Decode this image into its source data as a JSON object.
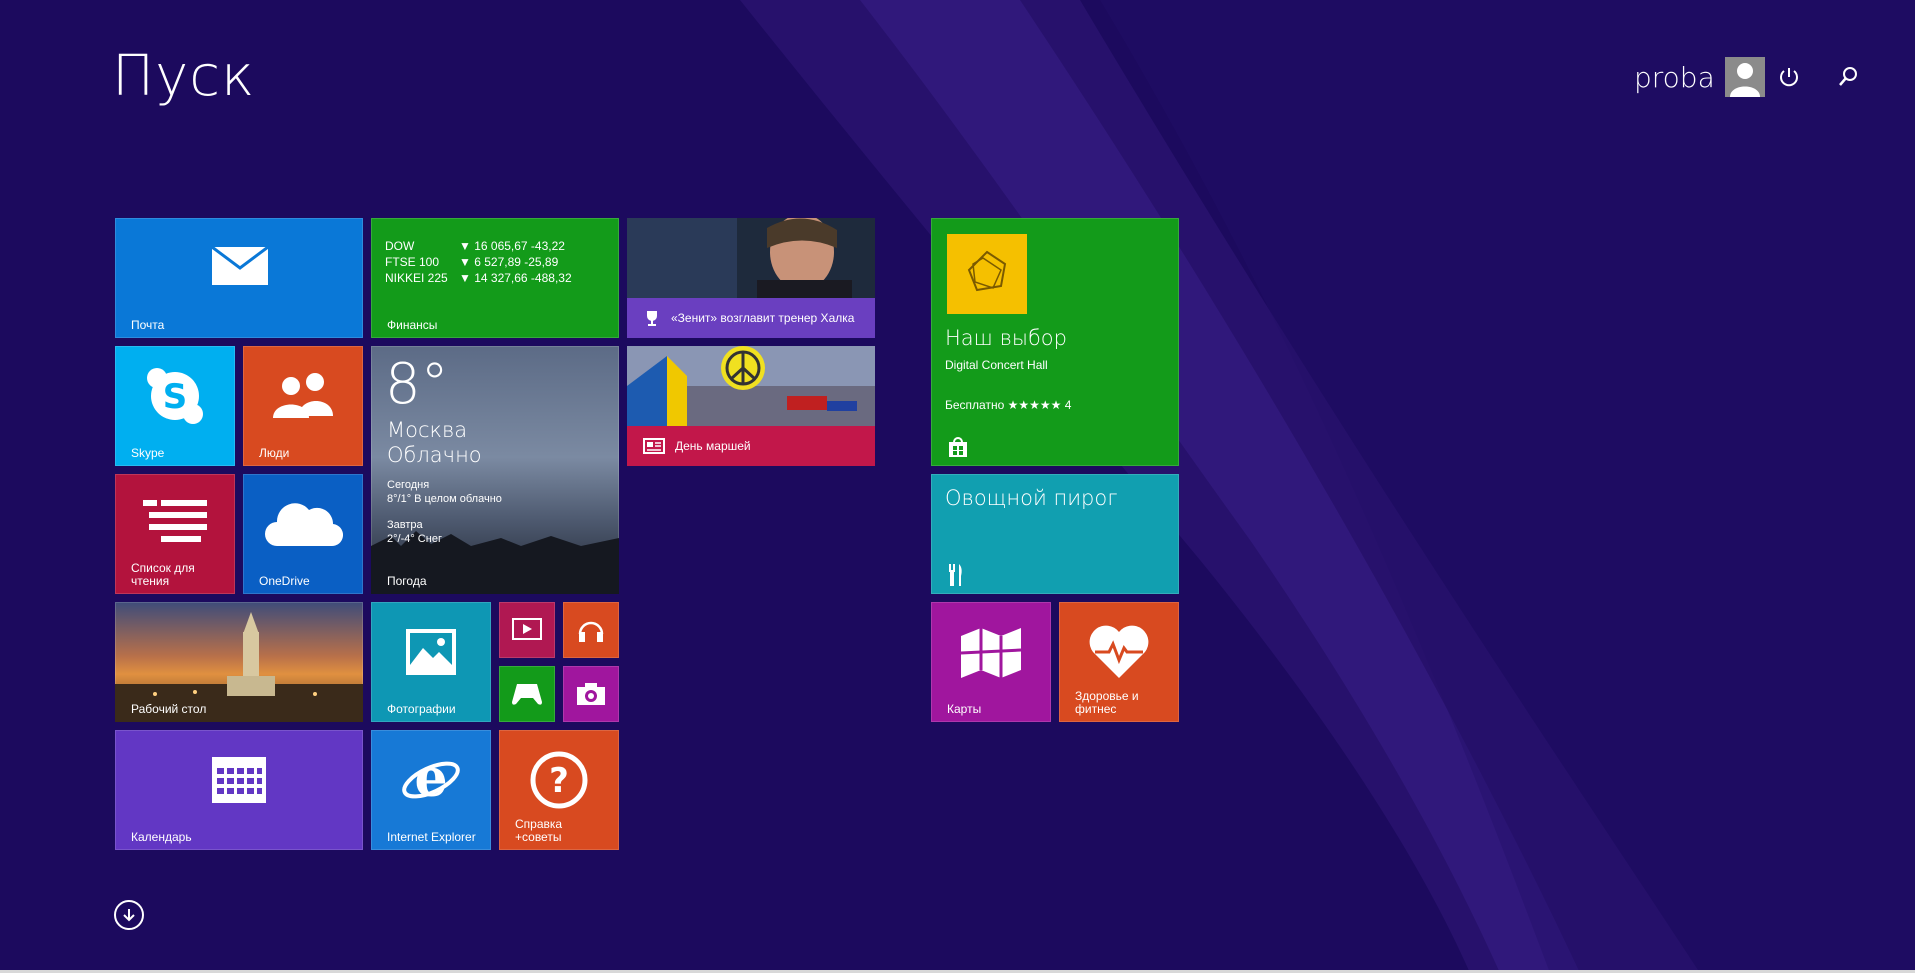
{
  "title": "Пуск",
  "user": {
    "name": "proba"
  },
  "colors": {
    "background": "#1c0a5e"
  },
  "tiles": {
    "mail": {
      "label": "Почта",
      "color": "#0a78d7"
    },
    "finance": {
      "label": "Финансы",
      "color": "#139b1a",
      "rows": [
        {
          "index": "DOW",
          "value": "▼ 16 065,67 -43,22"
        },
        {
          "index": "FTSE 100",
          "value": "▼ 6 527,89 -25,89"
        },
        {
          "index": "NIKKEI 225",
          "value": "▼ 14 327,66 -488,32"
        }
      ]
    },
    "sports": {
      "caption": "«Зенит» возглавит тренер Халка",
      "color": "#6a3fc0"
    },
    "skype": {
      "label": "Skype",
      "color": "#00aff0"
    },
    "people": {
      "label": "Люди",
      "color": "#d84a20"
    },
    "weather": {
      "label": "Погода",
      "temp": "8°",
      "city": "Москва",
      "condition": "Облачно",
      "today_label": "Сегодня",
      "today_value": "8°/1° В целом облачно",
      "tomorrow_label": "Завтра",
      "tomorrow_value": "2°/-4° Снег"
    },
    "news": {
      "caption": "День маршей",
      "color": "#c2174a"
    },
    "reading_list": {
      "label": "Список для чтения",
      "color": "#b3133d"
    },
    "onedrive": {
      "label": "OneDrive",
      "color": "#0a5fc4"
    },
    "desktop": {
      "label": "Рабочий стол"
    },
    "photos": {
      "label": "Фотографии",
      "color": "#0e97b4"
    },
    "video": {
      "color": "#b01852"
    },
    "music": {
      "color": "#d84a20"
    },
    "games": {
      "color": "#139b1a"
    },
    "camera": {
      "color": "#a0169e"
    },
    "calendar": {
      "label": "Календарь",
      "color": "#6237c4"
    },
    "ie": {
      "label": "Internet Explorer",
      "color": "#1779d6"
    },
    "help": {
      "label": "Справка +советы",
      "color": "#d84a20"
    },
    "store_pick": {
      "title": "Наш выбор",
      "subtitle": "Digital Concert Hall",
      "price": "Бесплатно ★★★★★ 4",
      "color": "#139b1a"
    },
    "food": {
      "title": "Овощной пирог",
      "color": "#119fb0"
    },
    "maps": {
      "label": "Карты",
      "color": "#a0169e"
    },
    "health": {
      "label": "Здоровье и фитнес",
      "color": "#d84a20"
    }
  }
}
